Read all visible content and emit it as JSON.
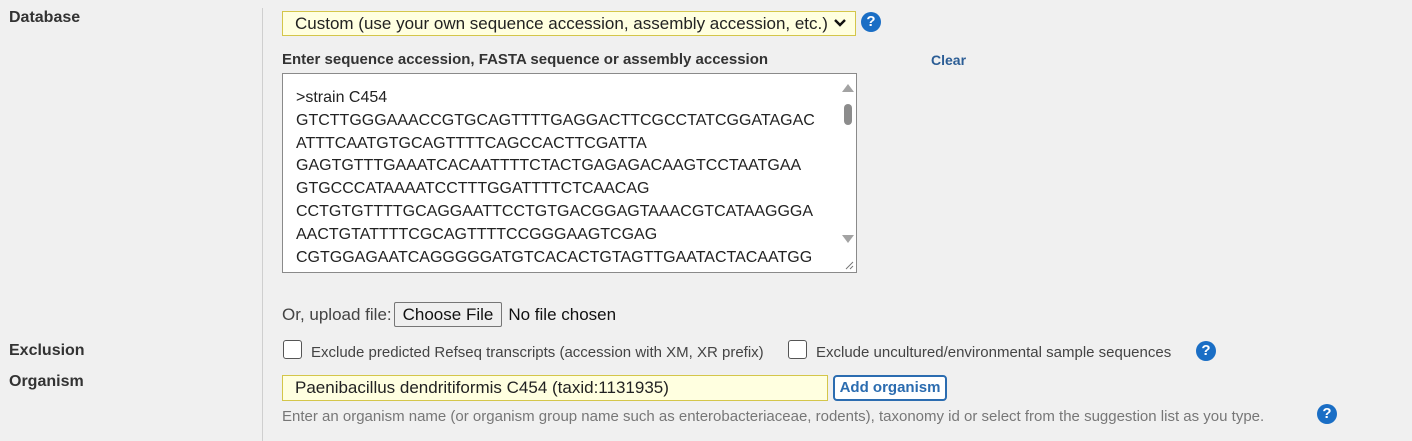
{
  "labels": {
    "database": "Database",
    "exclusion": "Exclusion",
    "organism": "Organism"
  },
  "database": {
    "selected": "Custom (use your own sequence accession, assembly accession, etc.)",
    "help_glyph": "?"
  },
  "sequence": {
    "label": "Enter sequence accession, FASTA sequence or assembly accession",
    "clear_label": "Clear",
    "lines": [
      ">strain C454",
      "GTCTTGGGAAACCGTGCAGTTTTGAGGACTTCGCCTATCGGATAGAC",
      "ATTTCAATGTGCAGTTTTCAGCCACTTCGATTA",
      "GAGTGTTTGAAATCACAATTTTCTACTGAGAGACAAGTCCTAATGAA",
      "GTGCCCATAAAATCCTTTGGATTTTCTCAACAG",
      "CCTGTGTTTTGCAGGAATTCCTGTGACGGAGTAAACGTCATAAGGGA",
      "AACTGTATTTTCGCAGTTTTCCGGGAAGTCGAG",
      "CGTGGAGAATCAGGGGGATGTCACACTGTAGTTGAATACTACAATGG"
    ]
  },
  "upload": {
    "label": "Or, upload file:",
    "button_label": "Choose File",
    "status": "No file chosen"
  },
  "exclusion": {
    "option1": "Exclude predicted Refseq transcripts (accession with XM, XR prefix)",
    "option2": "Exclude uncultured/environmental sample sequences",
    "help_glyph": "?"
  },
  "organism": {
    "value": "Paenibacillus dendritiformis C454 (taxid:1131935)",
    "add_label": "Add organism",
    "hint": "Enter an organism name (or organism group name such as enterobacteriaceae, rodents), taxonomy id or select from the suggestion list as you type.",
    "help_glyph": "?"
  },
  "colors": {
    "accent": "#1a6ec5",
    "field_highlight": "#ffffe0"
  }
}
